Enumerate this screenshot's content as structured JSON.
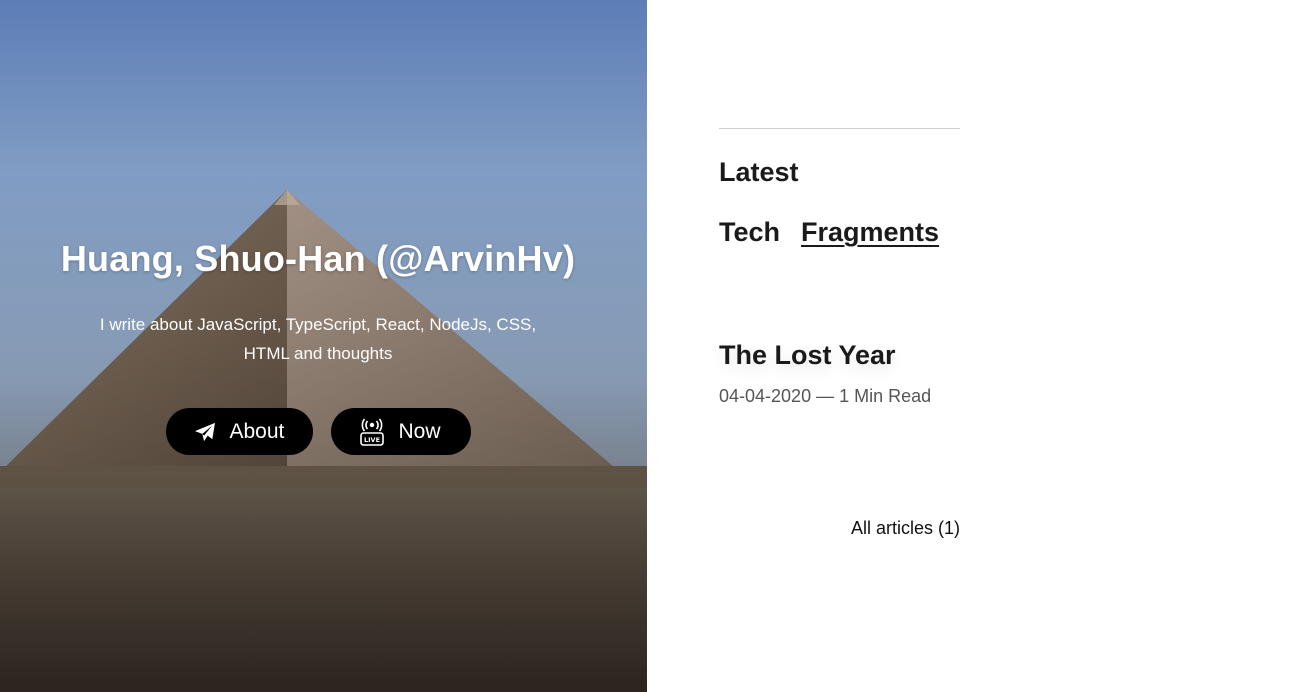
{
  "hero": {
    "title": "Huang, Shuo-Han (@ArvinHv)",
    "tagline": "I write about JavaScript, TypeScript, React, NodeJs, CSS, HTML and thoughts",
    "buttons": [
      {
        "label": "About",
        "icon": "paper-plane-icon"
      },
      {
        "label": "Now",
        "icon": "live-broadcast-icon"
      }
    ]
  },
  "main": {
    "section_title": "Latest",
    "tabs": [
      {
        "label": "Tech",
        "active": false
      },
      {
        "label": "Fragments",
        "active": true
      }
    ],
    "articles": [
      {
        "title": "The Lost Year",
        "date": "04-04-2020",
        "separator": "—",
        "read_time": "1 Min Read"
      }
    ],
    "all_articles_label": "All articles (1)"
  },
  "colors": {
    "accent": "#000000",
    "text": "#1a1a1a",
    "meta": "#555555",
    "divider": "#cfcfcf"
  }
}
